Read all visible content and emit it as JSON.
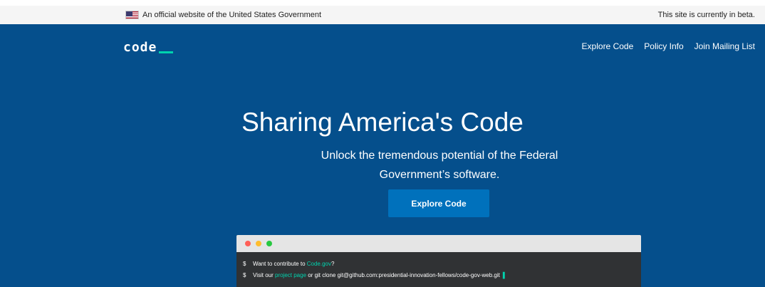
{
  "gov_banner": {
    "official_text": "An official website of the United States Government",
    "beta_text": "This site is currently in beta."
  },
  "brand": {
    "logo_text": "code",
    "cursor_color": "#00d3ae"
  },
  "nav": {
    "items": [
      "Explore Code",
      "Policy Info",
      "Join Mailing List"
    ]
  },
  "hero": {
    "title": "Sharing America's Code",
    "subtitle": "Unlock the tremendous potential of the Federal Government’s software.",
    "button_label": "Explore Code",
    "background_color": "#054f8c",
    "button_color": "#0071bc"
  },
  "terminal": {
    "line_1": {
      "prompt": "$",
      "before": "Want to contribute to ",
      "link": "Code.gov",
      "after": "?"
    },
    "line_2": {
      "prompt": "$",
      "before": "Visit our ",
      "link": "project page",
      "after": " or git clone git@github.com:presidential-innovation-fellows/code-gov-web.git",
      "cursor": "▌"
    }
  },
  "icons": {
    "flag": "us-flag-icon",
    "terminal_controls": [
      "close-dot-icon",
      "minimize-dot-icon",
      "maximize-dot-icon"
    ]
  }
}
